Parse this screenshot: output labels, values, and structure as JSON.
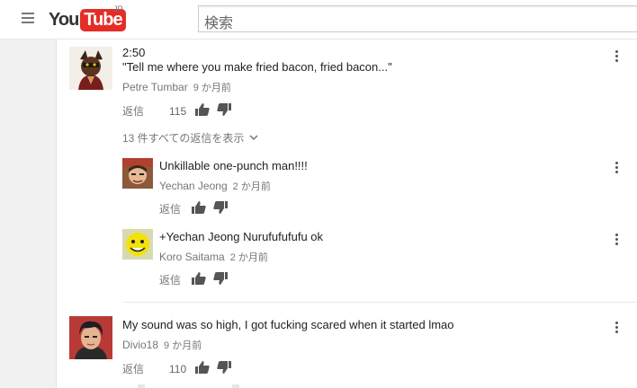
{
  "header": {
    "logo_you": "You",
    "logo_tube": "Tube",
    "logo_region": "JP",
    "search_placeholder": "検索"
  },
  "comments": [
    {
      "text_line1": "2:50",
      "text_line2": "\"Tell me where you make fried bacon, fried bacon...\"",
      "author": "Petre Tumbar",
      "time": "9 か月前",
      "reply_label": "返信",
      "likes": "115",
      "view_replies": "13 件すべての返信を表示",
      "replies": [
        {
          "text": "Unkillable one-punch man!!!!",
          "author": "Yechan Jeong",
          "time": "2 か月前",
          "reply_label": "返信"
        },
        {
          "text": "+Yechan Jeong Nurufufufufu ok",
          "author": "Koro Saitama",
          "time": "2 か月前",
          "reply_label": "返信"
        }
      ]
    },
    {
      "text": "My sound was so high, I got fucking scared when it started lmao",
      "author": "Divio18",
      "time": "9 か月前",
      "reply_label": "返信",
      "likes": "110"
    }
  ]
}
